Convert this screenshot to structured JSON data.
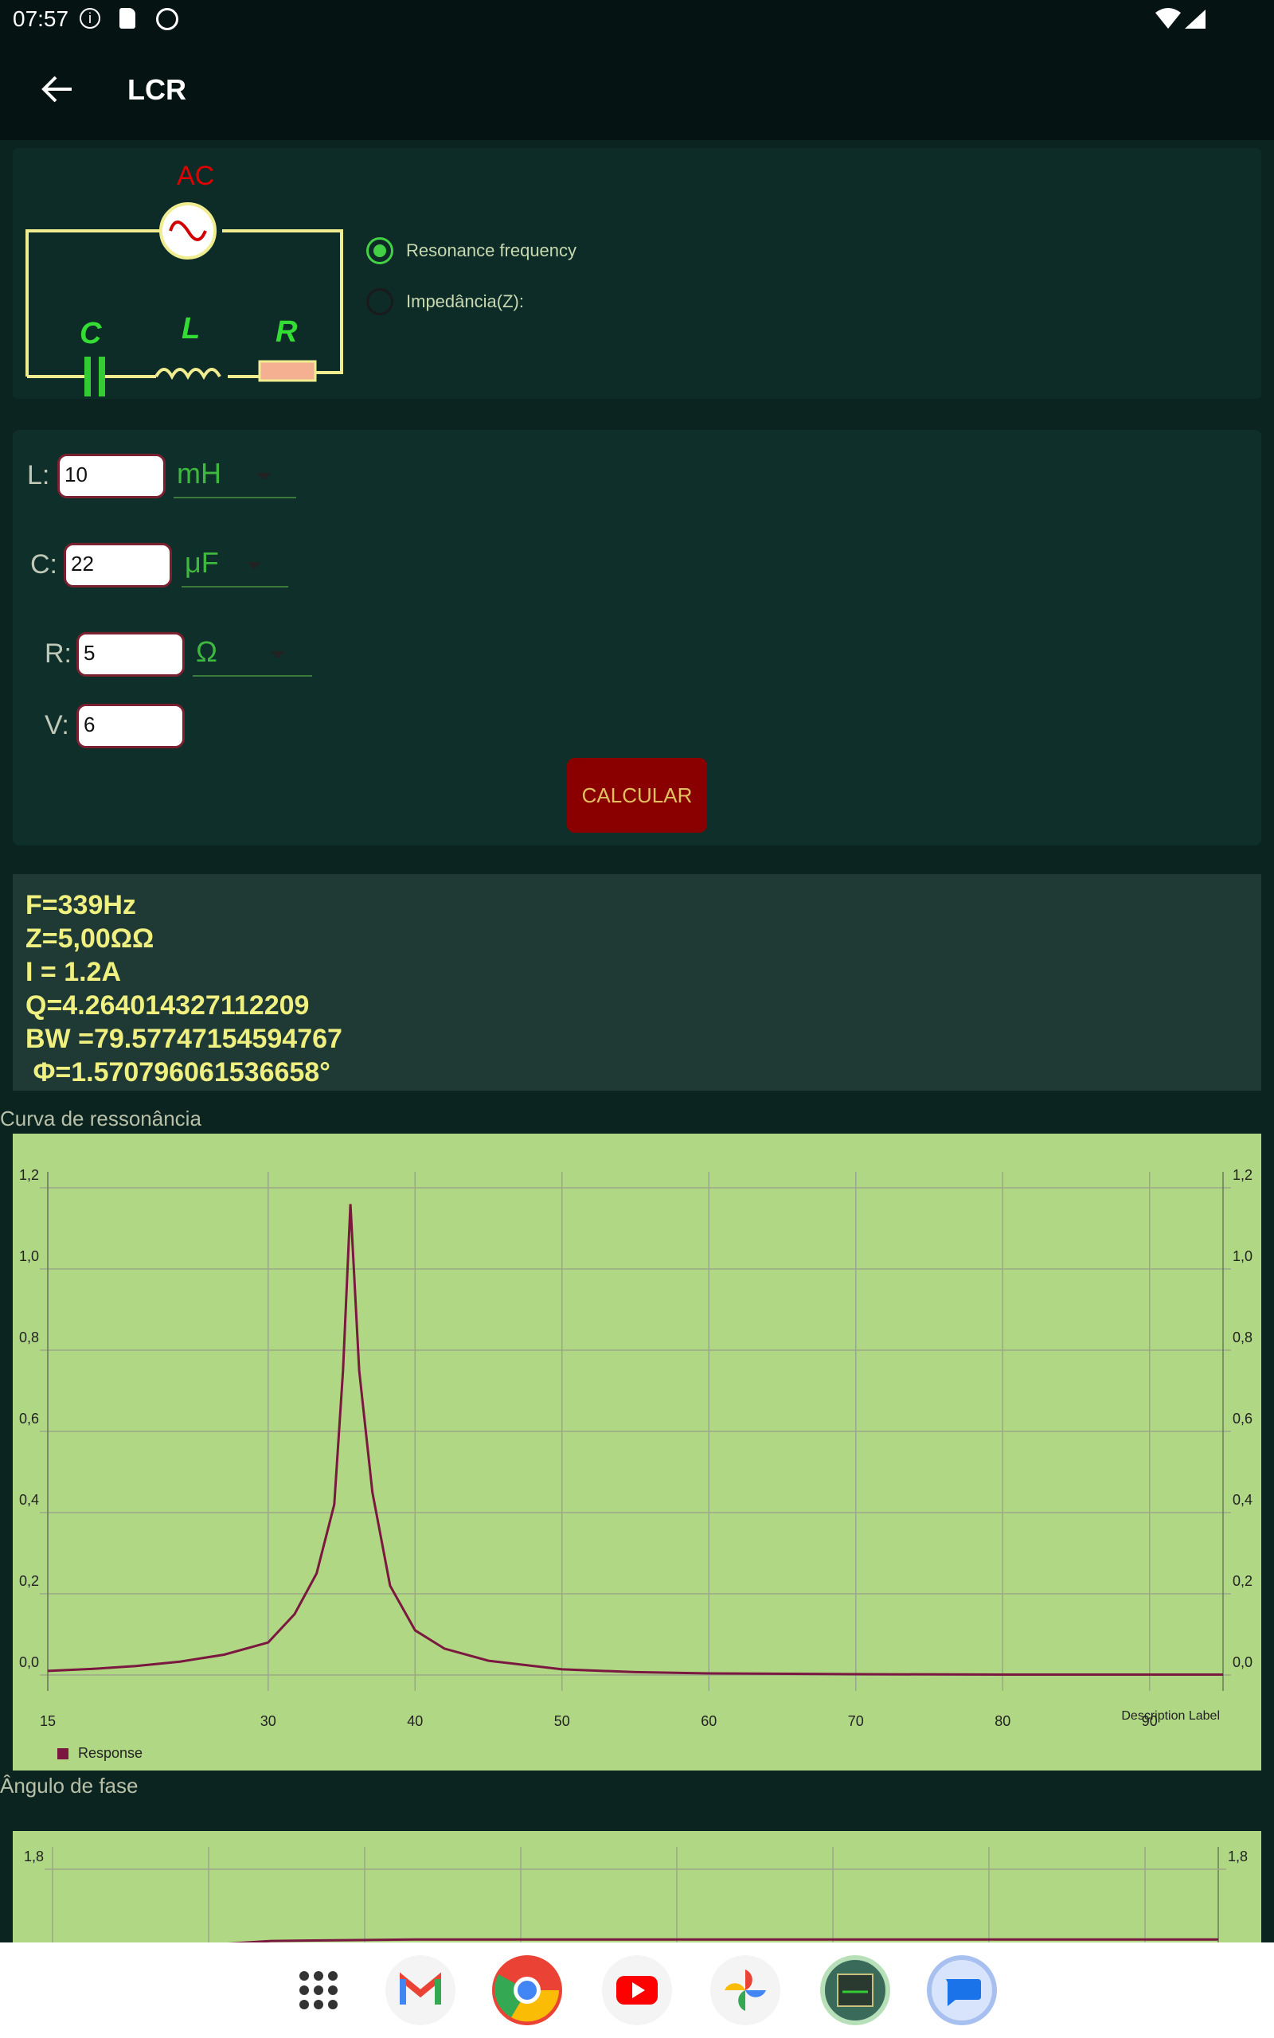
{
  "status_bar": {
    "time": "07:57"
  },
  "app_bar": {
    "title": "LCR"
  },
  "circuit": {
    "source_label": "AC",
    "capacitor_label": "C",
    "inductor_label": "L",
    "resistor_label": "R"
  },
  "mode_options": [
    {
      "label": "Resonance frequency",
      "selected": true
    },
    {
      "label": "Impedância(Z):",
      "selected": false
    }
  ],
  "inputs": {
    "L": {
      "label": "L:",
      "value": "10",
      "unit": "mH"
    },
    "C": {
      "label": "C:",
      "value": "22",
      "unit": "μF"
    },
    "R": {
      "label": "R:",
      "value": "5",
      "unit": "Ω"
    },
    "V": {
      "label": "V:",
      "value": "6"
    }
  },
  "calculate_button": "CALCULAR",
  "results": [
    "F=339Hz",
    "Z=5,00ΩΩ",
    "I = 1.2A",
    "Q=4.264014327112209",
    "BW =79.57747154594767",
    " Φ=1.570796061536658°"
  ],
  "section_titles": {
    "resonance": "Curva de ressonância",
    "phase": "Ângulo de fase"
  },
  "colors": {
    "chart_bg": "#b0d784",
    "series": "#7a1840",
    "accent_green": "#3fb83f",
    "button": "#8a0000",
    "result_text": "#f0f080"
  },
  "chart_data": [
    {
      "type": "line",
      "title": "",
      "xlabel": "",
      "ylabel": "",
      "xlim": [
        15,
        95
      ],
      "ylim": [
        0,
        1.2
      ],
      "x_ticks": [
        "15",
        "30",
        "40",
        "50",
        "60",
        "70",
        "80",
        "90"
      ],
      "y_ticks": [
        "0,0",
        "0,2",
        "0,4",
        "0,6",
        "0,8",
        "1,0",
        "1,2"
      ],
      "description_label": "Description Label",
      "legend": "bottom-left",
      "grid": true,
      "series": [
        {
          "name": "Response",
          "x": [
            15,
            18,
            21,
            24,
            27,
            30,
            31.8,
            33.3,
            34.5,
            35.1,
            35.6,
            36.2,
            37.1,
            38.3,
            40,
            42,
            45,
            50,
            55,
            60,
            70,
            80,
            90,
            95
          ],
          "y": [
            0.01,
            0.015,
            0.022,
            0.033,
            0.05,
            0.08,
            0.15,
            0.25,
            0.42,
            0.75,
            1.16,
            0.75,
            0.45,
            0.22,
            0.11,
            0.065,
            0.035,
            0.014,
            0.007,
            0.004,
            0.002,
            0.001,
            0.001,
            0.001
          ]
        }
      ]
    },
    {
      "type": "line",
      "title": "",
      "xlabel": "",
      "ylabel": "",
      "y_ticks": [
        "1,8"
      ],
      "grid": true,
      "series": [
        {
          "name": "",
          "x": [
            15,
            17,
            20,
            25,
            30,
            40,
            60,
            95
          ],
          "y": [
            1.2,
            1.45,
            1.52,
            1.55,
            1.565,
            1.57,
            1.57,
            1.57
          ]
        }
      ]
    }
  ],
  "dock_apps": [
    "apps-grid",
    "gmail",
    "chrome",
    "youtube",
    "photos",
    "lcr-app",
    "messages"
  ]
}
